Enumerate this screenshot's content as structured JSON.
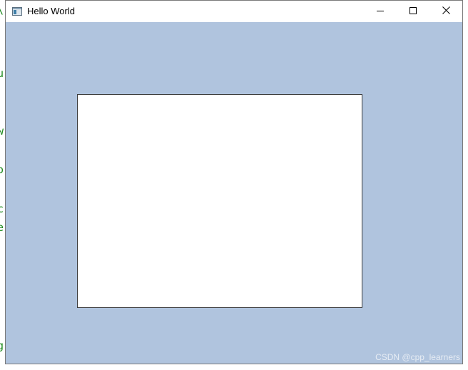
{
  "window": {
    "title": "Hello World",
    "icon": "app-window-icon",
    "controls": {
      "minimize": "minimize-icon",
      "maximize": "maximize-icon",
      "close": "close-icon"
    },
    "client_background": "#b0c4de",
    "canvas_background": "#ffffff"
  },
  "background_code": {
    "color": "#1e8a1e",
    "fragments": [
      "\\",
      "u",
      "w",
      "o",
      "c",
      "e",
      "g"
    ]
  },
  "watermark": {
    "text": "CSDN @cpp_learners"
  }
}
